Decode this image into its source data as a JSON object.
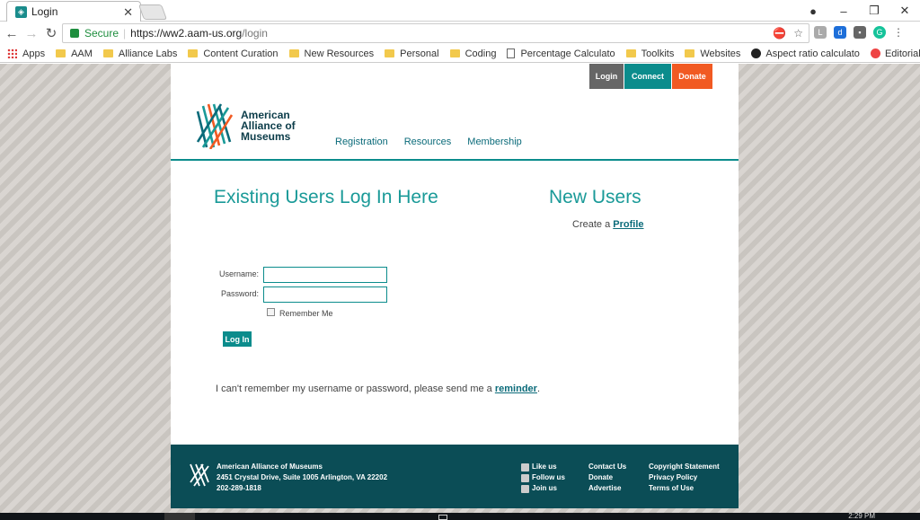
{
  "browser": {
    "tab_title": "Login",
    "tab_close": "✕",
    "window_controls": {
      "profile": "●",
      "minimize": "–",
      "restore": "❐",
      "close": "✕"
    },
    "nav": {
      "back": "←",
      "forward": "→",
      "reload": "↻"
    },
    "secure_label": "Secure",
    "url_scheme_host": "https://ww2.aam-us.org",
    "url_path": "/login",
    "bookmarks": [
      {
        "label": "Apps",
        "icon": "apps-grid-icon"
      },
      {
        "label": "AAM",
        "icon": "folder-icon"
      },
      {
        "label": "Alliance Labs",
        "icon": "folder-icon"
      },
      {
        "label": "Content Curation",
        "icon": "folder-icon"
      },
      {
        "label": "New Resources",
        "icon": "folder-icon"
      },
      {
        "label": "Personal",
        "icon": "folder-icon"
      },
      {
        "label": "Coding",
        "icon": "folder-icon"
      },
      {
        "label": "Percentage Calculato",
        "icon": "page-icon"
      },
      {
        "label": "Toolkits",
        "icon": "folder-icon"
      },
      {
        "label": "Websites",
        "icon": "folder-icon"
      },
      {
        "label": "Aspect ratio calculato",
        "icon": "site-icon"
      },
      {
        "label": "Editorial Calendar - A",
        "icon": "site-icon"
      }
    ]
  },
  "site": {
    "top_buttons": {
      "login": "Login",
      "connect": "Connect",
      "donate": "Donate"
    },
    "logo": {
      "line1": "American",
      "line2": "Alliance of",
      "line3": "Museums"
    },
    "nav": [
      "Registration",
      "Resources",
      "Membership"
    ],
    "existing_heading": "Existing Users Log In Here",
    "new_heading": "New Users",
    "create_prefix": "Create a",
    "create_link": "Profile",
    "form": {
      "username_label": "Username:",
      "password_label": "Password:",
      "username_value": "",
      "password_value": "",
      "remember_label": "Remember Me",
      "submit_label": "Log In"
    },
    "forgot_prefix": "I can't remember my username or password, please send me a",
    "forgot_link": "reminder",
    "forgot_suffix": "."
  },
  "footer": {
    "org_name": "American Alliance of Museums",
    "address": "2451 Crystal Drive, Suite 1005 Arlington, VA 22202",
    "phone": "202-289-1818",
    "social": [
      "Like us",
      "Follow us",
      "Join us"
    ],
    "links_col1": [
      "Contact Us",
      "Donate",
      "Advertise"
    ],
    "links_col2": [
      "Copyright Statement",
      "Privacy Policy",
      "Terms of Use"
    ]
  },
  "taskbar": {
    "clock": "2:29 PM"
  },
  "colors": {
    "teal": "#0b8c8c",
    "dark_teal": "#0b4d56",
    "orange": "#f15a22",
    "heading": "#1a9a98"
  }
}
